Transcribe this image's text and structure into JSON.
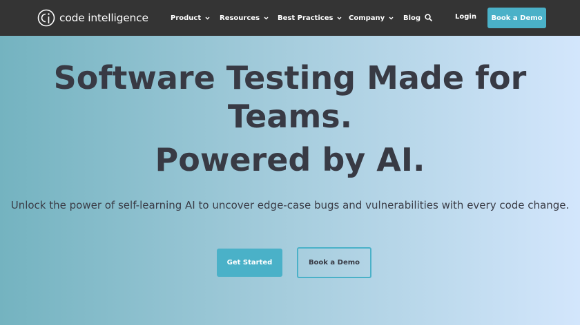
{
  "nav": {
    "logo_text": "code intelligence",
    "items": [
      {
        "label": "Product",
        "has_dropdown": true
      },
      {
        "label": "Resources",
        "has_dropdown": true
      },
      {
        "label": "Best Practices",
        "has_dropdown": true
      },
      {
        "label": "Company",
        "has_dropdown": true
      },
      {
        "label": "Blog",
        "has_dropdown": false
      }
    ],
    "search_icon": "search-icon",
    "login_label": "Login",
    "demo_label": "Book a Demo"
  },
  "hero": {
    "headline_line1": "Software Testing Made for",
    "headline_line2": "Teams.",
    "headline_line3": "Powered by AI.",
    "subtitle": "Unlock the power of self-learning AI to uncover edge-case bugs and vulnerabilities with every code change.",
    "primary_cta": "Get Started",
    "secondary_cta": "Book a Demo"
  },
  "colors": {
    "nav_bg": "#343434",
    "accent": "#4ab1c8",
    "headline": "#383a44"
  }
}
